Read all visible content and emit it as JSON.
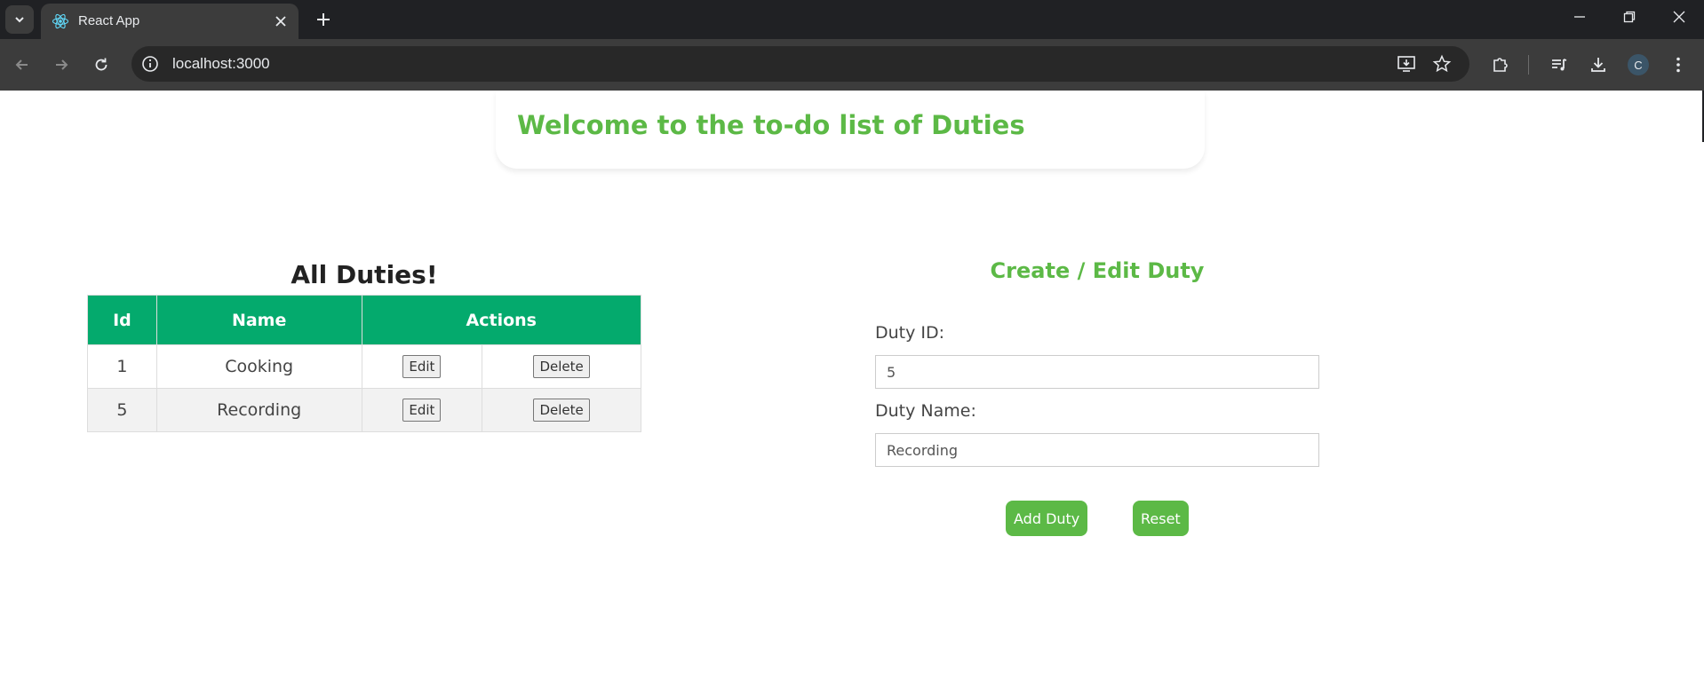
{
  "browser": {
    "tab_title": "React App",
    "url": "localhost:3000",
    "profile_initial": "C",
    "accent": "#202124"
  },
  "header": {
    "title": "Welcome to the to-do list of Duties"
  },
  "duties_table": {
    "title": "All Duties!",
    "columns": [
      "Id",
      "Name",
      "Actions"
    ],
    "rows": [
      {
        "id": "1",
        "name": "Cooking",
        "edit_label": "Edit",
        "delete_label": "Delete"
      },
      {
        "id": "5",
        "name": "Recording",
        "edit_label": "Edit",
        "delete_label": "Delete"
      }
    ]
  },
  "form": {
    "title": "Create / Edit Duty",
    "id_label": "Duty ID:",
    "id_value": "5",
    "name_label": "Duty Name:",
    "name_value": "Recording",
    "add_button": "Add Duty",
    "reset_button": "Reset"
  },
  "colors": {
    "brand_green": "#5cb946",
    "table_header": "#04aa6d"
  }
}
